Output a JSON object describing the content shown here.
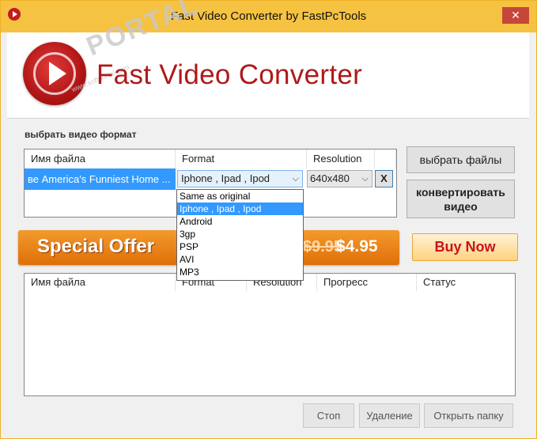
{
  "window": {
    "title": "Fast Video Converter by FastPcTools",
    "close_glyph": "✕",
    "accent_color": "#f5c242"
  },
  "banner": {
    "app_name": "Fast Video Converter",
    "watermark": "PORTAL",
    "watermark_small": "www.softportal.com"
  },
  "format_section": {
    "label": "выбрать видео формат",
    "columns": [
      "Имя файла",
      "Format",
      "Resolution"
    ],
    "row": {
      "file": "ве America's Funniest Home ...",
      "format": "Iphone , Ipad , Ipod",
      "resolution": "640x480",
      "remove": "X"
    }
  },
  "buttons": {
    "choose_files": "выбрать файлы",
    "convert": "конвертировать видео",
    "stop": "Стоп",
    "delete": "Удаление",
    "open_folder": "Открыть папку"
  },
  "offer": {
    "text": "Special Offer",
    "old_price": "$9.95",
    "new_price": "$4.95",
    "buy_now": "Buy Now"
  },
  "format_dropdown": {
    "options": [
      "Same as original",
      "Iphone , Ipad , Ipod",
      "Android",
      "3gp",
      "PSP",
      "AVI",
      "MP3"
    ],
    "selected_index": 1
  },
  "queue": {
    "columns": [
      "Имя файла",
      "Format",
      "Resolution",
      "Прогресс",
      "Статус"
    ]
  }
}
